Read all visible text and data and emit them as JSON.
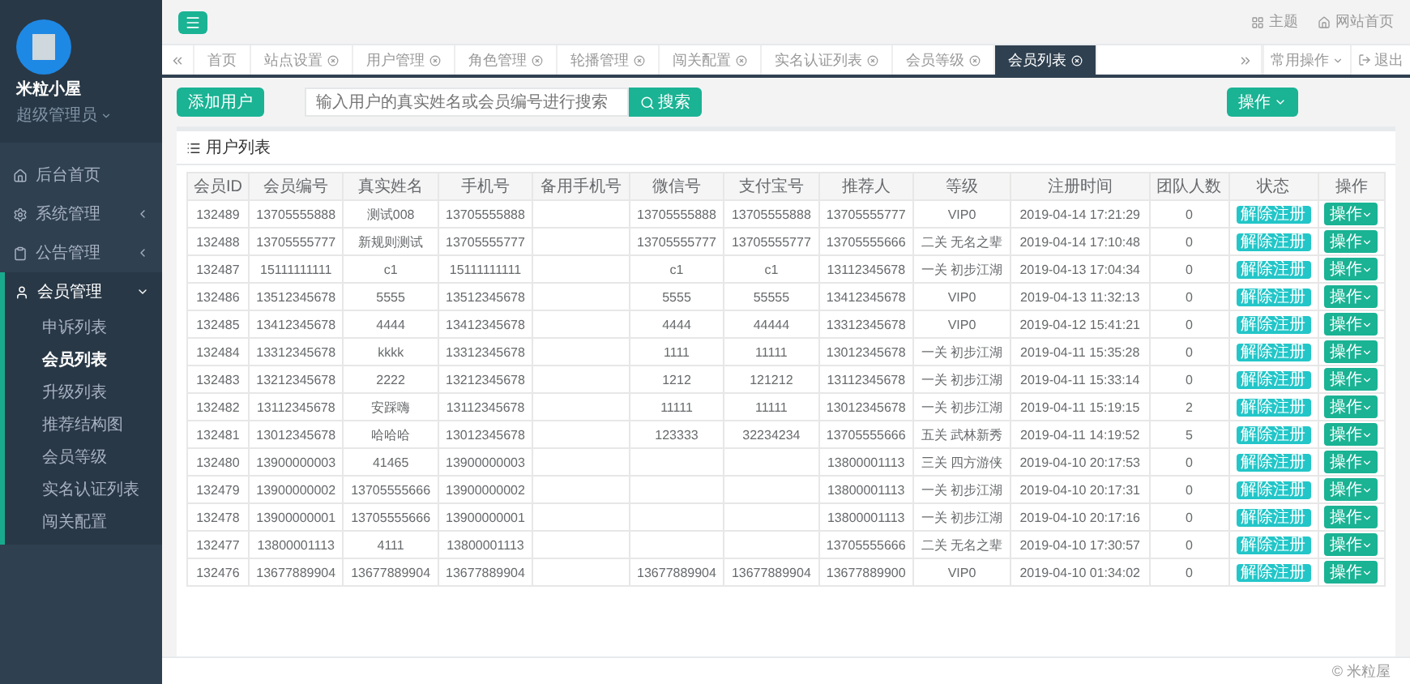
{
  "sidebar": {
    "user": {
      "name": "米粒小屋",
      "role": "超级管理员"
    },
    "items": [
      {
        "label": "后台首页",
        "kind": "home",
        "expanded": false
      },
      {
        "label": "系统管理",
        "kind": "gear",
        "expanded": false
      },
      {
        "label": "公告管理",
        "kind": "notice",
        "expanded": false
      },
      {
        "label": "会员管理",
        "kind": "user",
        "expanded": true,
        "children": [
          {
            "label": "申诉列表",
            "selected": false
          },
          {
            "label": "会员列表",
            "selected": true
          },
          {
            "label": "升级列表",
            "selected": false
          },
          {
            "label": "推荐结构图",
            "selected": false
          },
          {
            "label": "会员等级",
            "selected": false
          },
          {
            "label": "实名认证列表",
            "selected": false
          },
          {
            "label": "闯关配置",
            "selected": false
          }
        ]
      }
    ]
  },
  "topbar": {
    "links": [
      {
        "label": "主题",
        "kind": "theme"
      },
      {
        "label": "网站首页",
        "kind": "home"
      }
    ]
  },
  "tabs": [
    {
      "label": "首页",
      "closable": false,
      "selected": false
    },
    {
      "label": "站点设置",
      "closable": true,
      "selected": false
    },
    {
      "label": "用户管理",
      "closable": true,
      "selected": false
    },
    {
      "label": "角色管理",
      "closable": true,
      "selected": false
    },
    {
      "label": "轮播管理",
      "closable": true,
      "selected": false
    },
    {
      "label": "闯关配置",
      "closable": true,
      "selected": false
    },
    {
      "label": "实名认证列表",
      "closable": true,
      "selected": false
    },
    {
      "label": "会员等级",
      "closable": true,
      "selected": false
    },
    {
      "label": "会员列表",
      "closable": true,
      "selected": true
    }
  ],
  "tab_actions": {
    "menu": "常用操作",
    "logout": "退出"
  },
  "toolbar": {
    "add": "添加用户",
    "search": {
      "placeholder": "输入用户的真实姓名或会员编号进行搜索",
      "button": "搜索"
    },
    "actions": "操作"
  },
  "panel": {
    "title": "用户列表"
  },
  "table": {
    "columns": [
      "会员ID",
      "会员编号",
      "真实姓名",
      "手机号",
      "备用手机号",
      "微信号",
      "支付宝号",
      "推荐人",
      "等级",
      "注册时间",
      "团队人数",
      "状态",
      "操作"
    ],
    "rows": [
      {
        "cells": [
          "132489",
          "13705555888",
          "测试008",
          "13705555888",
          "",
          "13705555888",
          "13705555888",
          "13705555777",
          "VIP0",
          "2019-04-14 17:21:29",
          "0"
        ],
        "status": "解除注册",
        "action": "操作"
      },
      {
        "cells": [
          "132488",
          "13705555777",
          "新规则测试",
          "13705555777",
          "",
          "13705555777",
          "13705555777",
          "13705555666",
          "二关 无名之辈",
          "2019-04-14 17:10:48",
          "0"
        ],
        "status": "解除注册",
        "action": "操作"
      },
      {
        "cells": [
          "132487",
          "15111111111",
          "c1",
          "15111111111",
          "",
          "c1",
          "c1",
          "13112345678",
          "一关 初步江湖",
          "2019-04-13 17:04:34",
          "0"
        ],
        "status": "解除注册",
        "action": "操作"
      },
      {
        "cells": [
          "132486",
          "13512345678",
          "5555",
          "13512345678",
          "",
          "5555",
          "55555",
          "13412345678",
          "VIP0",
          "2019-04-13 11:32:13",
          "0"
        ],
        "status": "解除注册",
        "action": "操作"
      },
      {
        "cells": [
          "132485",
          "13412345678",
          "4444",
          "13412345678",
          "",
          "4444",
          "44444",
          "13312345678",
          "VIP0",
          "2019-04-12 15:41:21",
          "0"
        ],
        "status": "解除注册",
        "action": "操作"
      },
      {
        "cells": [
          "132484",
          "13312345678",
          "kkkk",
          "13312345678",
          "",
          "1111",
          "11111",
          "13012345678",
          "一关 初步江湖",
          "2019-04-11 15:35:28",
          "0"
        ],
        "status": "解除注册",
        "action": "操作"
      },
      {
        "cells": [
          "132483",
          "13212345678",
          "2222",
          "13212345678",
          "",
          "1212",
          "121212",
          "13112345678",
          "一关 初步江湖",
          "2019-04-11 15:33:14",
          "0"
        ],
        "status": "解除注册",
        "action": "操作"
      },
      {
        "cells": [
          "132482",
          "13112345678",
          "安踩嗨",
          "13112345678",
          "",
          "11111",
          "11111",
          "13012345678",
          "一关 初步江湖",
          "2019-04-11 15:19:15",
          "2"
        ],
        "status": "解除注册",
        "action": "操作"
      },
      {
        "cells": [
          "132481",
          "13012345678",
          "哈哈哈",
          "13012345678",
          "",
          "123333",
          "32234234",
          "13705555666",
          "五关 武林新秀",
          "2019-04-11 14:19:52",
          "5"
        ],
        "status": "解除注册",
        "action": "操作"
      },
      {
        "cells": [
          "132480",
          "13900000003",
          "41465",
          "13900000003",
          "",
          "",
          "",
          "13800001113",
          "三关 四方游侠",
          "2019-04-10 20:17:53",
          "0"
        ],
        "status": "解除注册",
        "action": "操作"
      },
      {
        "cells": [
          "132479",
          "13900000002",
          "13705555666",
          "13900000002",
          "",
          "",
          "",
          "13800001113",
          "一关 初步江湖",
          "2019-04-10 20:17:31",
          "0"
        ],
        "status": "解除注册",
        "action": "操作"
      },
      {
        "cells": [
          "132478",
          "13900000001",
          "13705555666",
          "13900000001",
          "",
          "",
          "",
          "13800001113",
          "一关 初步江湖",
          "2019-04-10 20:17:16",
          "0"
        ],
        "status": "解除注册",
        "action": "操作"
      },
      {
        "cells": [
          "132477",
          "13800001113",
          "4111",
          "13800001113",
          "",
          "",
          "",
          "13705555666",
          "二关 无名之辈",
          "2019-04-10 17:30:57",
          "0"
        ],
        "status": "解除注册",
        "action": "操作"
      },
      {
        "cells": [
          "132476",
          "13677889904",
          "13677889904",
          "13677889904",
          "",
          "13677889904",
          "13677889904",
          "13677889900",
          "VIP0",
          "2019-04-10 01:34:02",
          "0"
        ],
        "status": "解除注册",
        "action": "操作"
      }
    ]
  },
  "footer": "© 米粒屋"
}
